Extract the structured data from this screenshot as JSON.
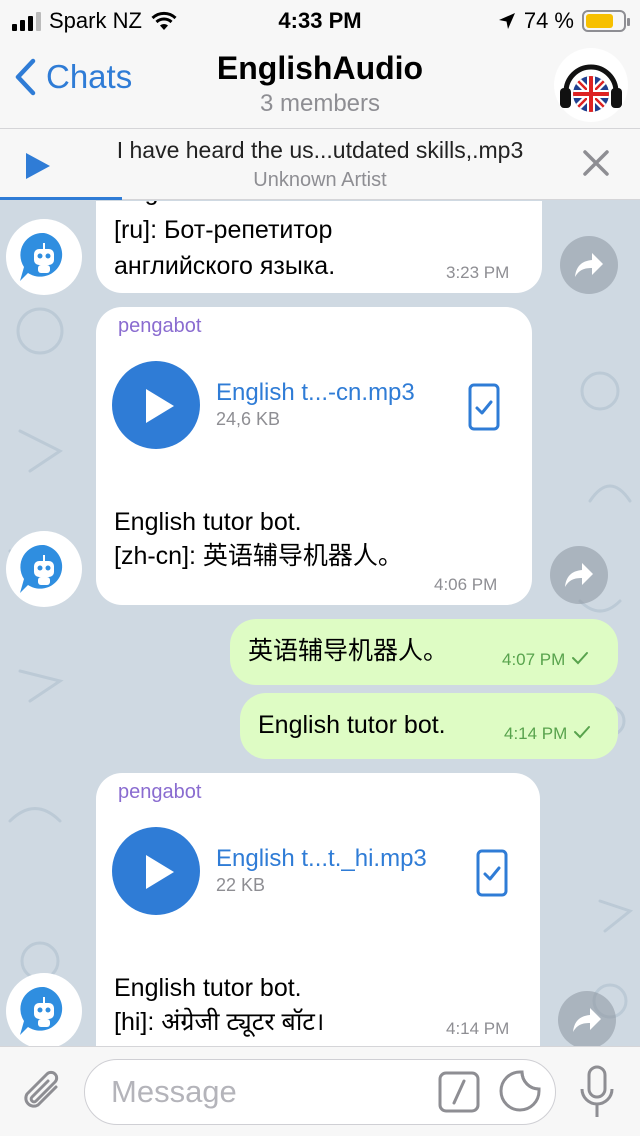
{
  "status_bar": {
    "carrier": "Spark NZ",
    "time": "4:33 PM",
    "battery_percent": "74 %",
    "battery_level": 0.74
  },
  "nav": {
    "back_label": "Chats",
    "title": "EnglishAudio",
    "subtitle": "3 members"
  },
  "player": {
    "title": "I have heard the us...utdated skills,.mp3",
    "artist": "Unknown Artist",
    "progress": 0.19
  },
  "messages": [
    {
      "type": "incoming",
      "text_lines": [
        "English tutor bot.",
        "[ru]: Бот-репетитор",
        "английского языка."
      ],
      "time": "3:23 PM"
    },
    {
      "type": "incoming-audio",
      "sender": "pengabot",
      "file_name": "English t...-cn.mp3",
      "file_size": "24,6 KB",
      "text_lines": [
        "English tutor bot.",
        "[zh-cn]: 英语辅导机器人。"
      ],
      "time": "4:06 PM"
    },
    {
      "type": "outgoing",
      "text": "英语辅导机器人。",
      "time": "4:07 PM"
    },
    {
      "type": "outgoing",
      "text": "English tutor bot.",
      "time": "4:14 PM"
    },
    {
      "type": "incoming-audio",
      "sender": "pengabot",
      "file_name": "English t...t._hi.mp3",
      "file_size": "22 KB",
      "text_lines": [
        "English tutor bot.",
        "[hi]: अंग्रेजी ट्यूटर बॉट।"
      ],
      "time": "4:14 PM"
    }
  ],
  "input": {
    "placeholder": "Message"
  },
  "colors": {
    "accent": "#2f7cd6",
    "outgoing_bubble": "#defcc4",
    "sender_name": "#8a6cd0",
    "chat_background": "#cfd9e2"
  },
  "icons": [
    "back-chevron-icon",
    "uk-headphones-avatar-icon",
    "play-icon",
    "close-icon",
    "bot-avatar-icon",
    "share-icon",
    "save-to-files-icon",
    "paperclip-icon",
    "bot-command-icon",
    "sticker-icon",
    "microphone-icon"
  ]
}
